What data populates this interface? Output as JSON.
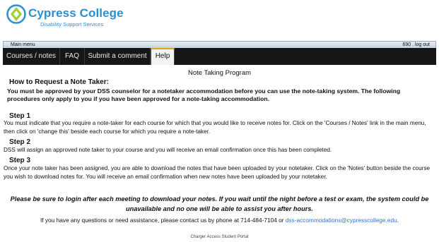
{
  "logo": {
    "title": "Cypress College",
    "subtitle": "Disability Support Services"
  },
  "mainmenu": {
    "label": "Main menu",
    "user_id": "690",
    "separator": " . ",
    "logout": "log out"
  },
  "nav": {
    "tabs": [
      {
        "label": "Courses / notes"
      },
      {
        "label": "FAQ"
      },
      {
        "label": "Submit a comment"
      },
      {
        "label": "Help"
      }
    ]
  },
  "content": {
    "page_title": "Note Taking Program",
    "heading": "How to Request a Note Taker:",
    "intro": "You must be approved by your DSS counselor for a notetaker accommodation before you can use the note-taking system. The following procedures only apply to you if you have been approved for a note-taking accommodation.",
    "steps": [
      {
        "title": "Step 1",
        "text": "You must indicate that you require a note-taker for each course for which that you would like to receive notes for. Click on the 'Courses / Notes' link in the main menu, then click on 'change this' beside each course for which you require a note-taker."
      },
      {
        "title": "Step 2",
        "text": "DSS will assign an approved note taker to your course and you will receive an email confirmation once this has been completed."
      },
      {
        "title": "Step 3",
        "text": "Once your note taker has been assigned, you are able to download the notes that have been uploaded by your notetaker. Click on the 'Notes' button beside the course you wish to download notes for. You will receive an email confirmation when new notes have been uploaded by your notetaker."
      }
    ],
    "warning": "Please be sure to login after each meeting to download your notes. If you wait until the night before a test or exam, the system could be unavailable and no one will be able to assist you after hours.",
    "contact_text": "If you have any questions or need assistance, please contact us by phone at 714-484-7104 or ",
    "contact_email": "dss-accommodations@cypresscollege.edu",
    "contact_end": "."
  },
  "footer": "Charger Access Student Portal",
  "colors": {
    "brand": "#2a8fd0",
    "nav_bg": "#161616",
    "active_tab_accent": "#e4a21a",
    "link": "#2a73c9"
  },
  "icons": {
    "logo": "cypress-college-logo-icon"
  }
}
